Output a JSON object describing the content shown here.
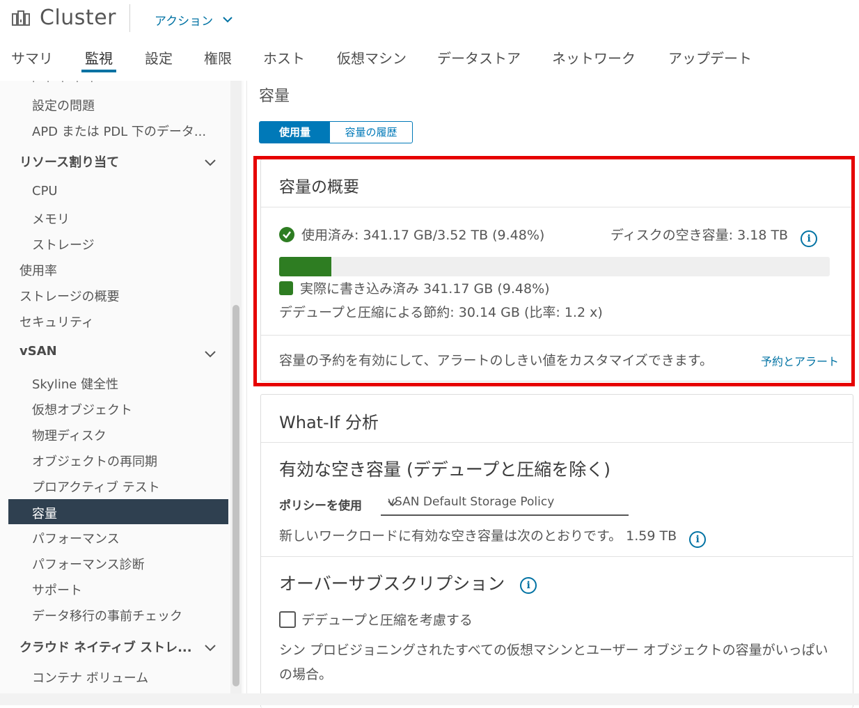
{
  "header": {
    "title": "Cluster",
    "actions_label": "アクション"
  },
  "tabs": [
    {
      "label": "サマリ"
    },
    {
      "label": "監視"
    },
    {
      "label": "設定"
    },
    {
      "label": "権限"
    },
    {
      "label": "ホスト"
    },
    {
      "label": "仮想マシン"
    },
    {
      "label": "データストア"
    },
    {
      "label": "ネットワーク"
    },
    {
      "label": "アップデート"
    }
  ],
  "sidebar": {
    "items": [
      {
        "label": "設定の問題"
      },
      {
        "label": "APD または PDL 下のデータ..."
      },
      {
        "label": "リソース割り当て"
      },
      {
        "label": "CPU"
      },
      {
        "label": "メモリ"
      },
      {
        "label": "ストレージ"
      },
      {
        "label": "使用率"
      },
      {
        "label": "ストレージの概要"
      },
      {
        "label": "セキュリティ"
      },
      {
        "label": "vSAN"
      },
      {
        "label": "Skyline 健全性"
      },
      {
        "label": "仮想オブジェクト"
      },
      {
        "label": "物理ディスク"
      },
      {
        "label": "オブジェクトの再同期"
      },
      {
        "label": "プロアクティブ テスト"
      },
      {
        "label": "容量"
      },
      {
        "label": "パフォーマンス"
      },
      {
        "label": "パフォーマンス診断"
      },
      {
        "label": "サポート"
      },
      {
        "label": "データ移行の事前チェック"
      },
      {
        "label": "クラウド ネイティブ ストレ..."
      },
      {
        "label": "コンテナ ボリューム"
      }
    ]
  },
  "main": {
    "title": "容量",
    "toggle": {
      "usage": "使用量",
      "history": "容量の履歴"
    },
    "overview": {
      "title": "容量の概要",
      "used": "使用済み: 341.17 GB/3.52 TB (9.48%)",
      "free": "ディスクの空き容量: 3.18 TB",
      "used_fraction": 0.0948,
      "written": "実際に書き込み済み 341.17 GB (9.48%)",
      "dedup": "デデュープと圧縮による節約: 30.14 GB (比率: 1.2 x)",
      "footer": "容量の予約を有効にして、アラートのしきい値をカスタマイズできます。",
      "footer_link": "予約とアラート",
      "accent": "#2e7d22"
    },
    "whatif": {
      "title": "What-If 分析",
      "effective_title": "有効な空き容量 (デデュープと圧縮を除く)",
      "policy_label": "ポリシーを使用",
      "policy_value": "vSAN Default Storage Policy",
      "free_text": "新しいワークロードに有効な空き容量は次のとおりです。 1.59 TB",
      "oversub_title": "オーバーサブスクリプション",
      "checkbox_label": "デデュープと圧縮を考慮する",
      "description": "シン プロビジョニングされたすべての仮想マシンとユーザー オブジェクトの容量がいっぱいの場合。"
    }
  },
  "icons": {
    "info": "i"
  }
}
